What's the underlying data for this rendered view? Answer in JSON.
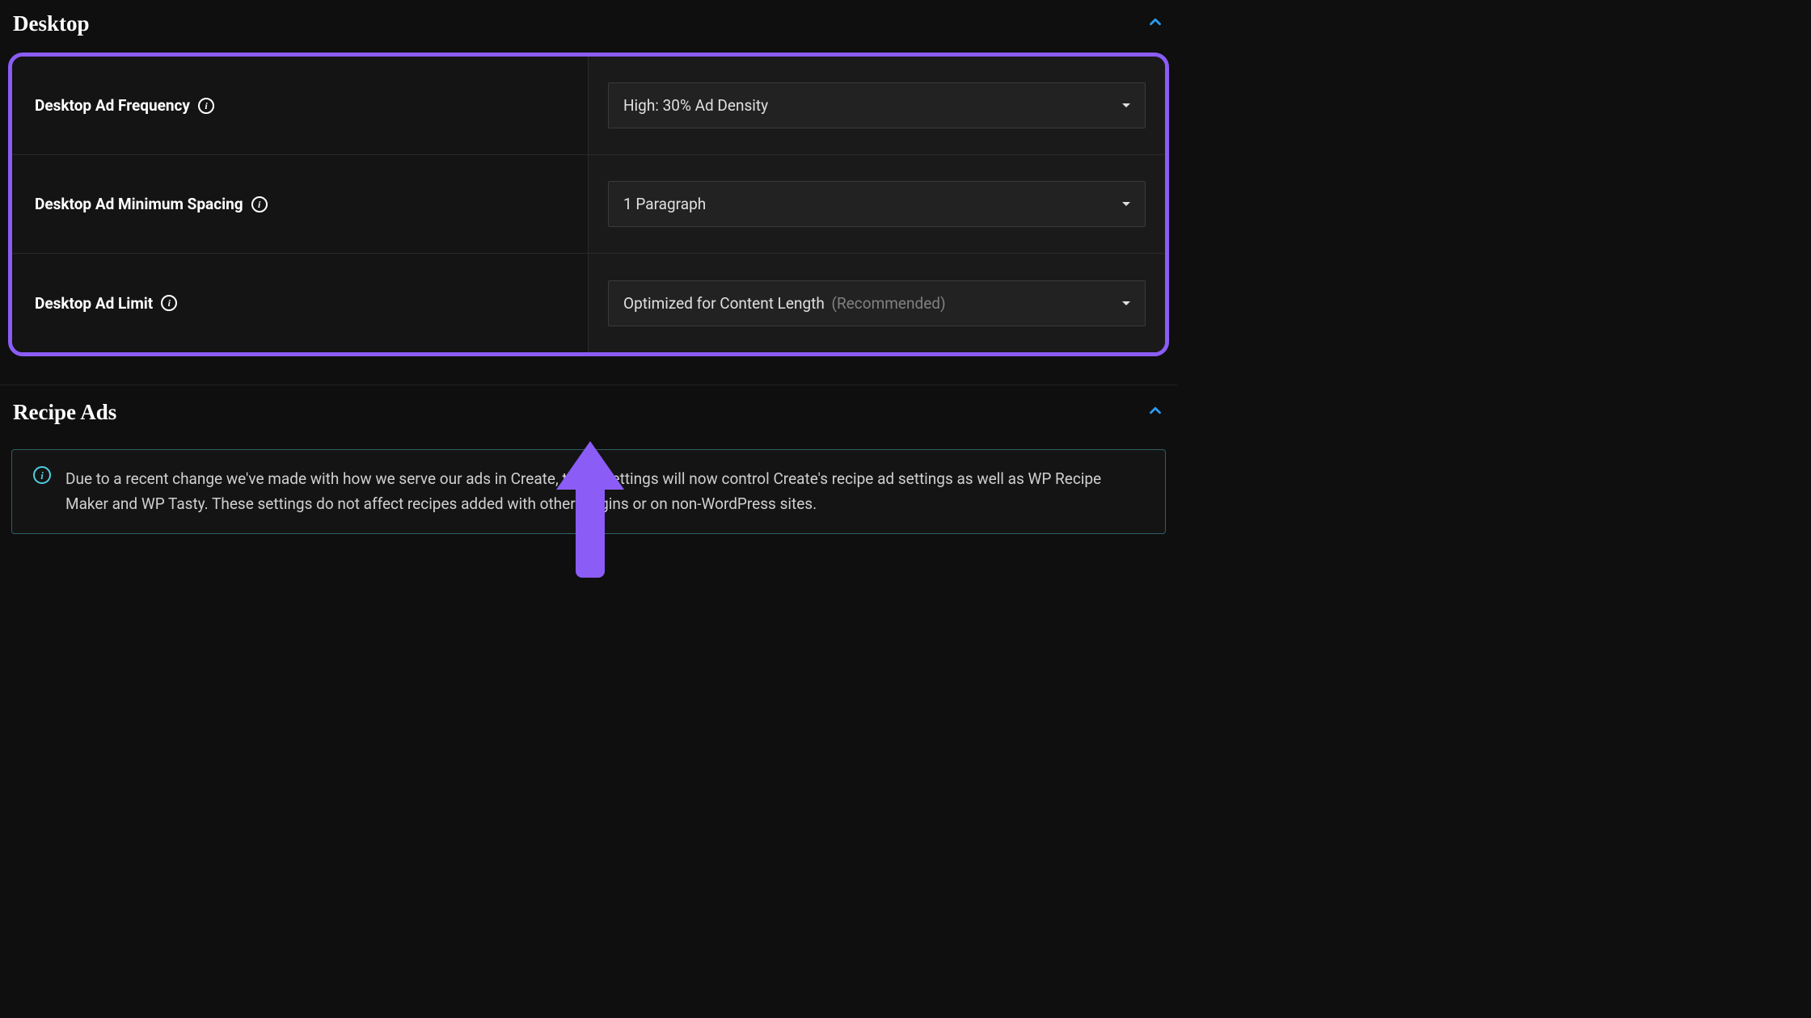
{
  "sections": {
    "desktop": {
      "title": "Desktop",
      "rows": [
        {
          "label": "Desktop Ad Frequency",
          "value": "High: 30% Ad Density",
          "hint": ""
        },
        {
          "label": "Desktop Ad Minimum Spacing",
          "value": "1 Paragraph",
          "hint": ""
        },
        {
          "label": "Desktop Ad Limit",
          "value": "Optimized for Content Length",
          "hint": "(Recommended)"
        }
      ]
    },
    "recipe": {
      "title": "Recipe Ads",
      "notice": "Due to a recent change we've made with how we serve our ads in Create, these settings will now control Create's recipe ad settings as well as WP Recipe Maker and WP Tasty. These settings do not affect recipes added with other plugins or on non-WordPress sites."
    }
  }
}
